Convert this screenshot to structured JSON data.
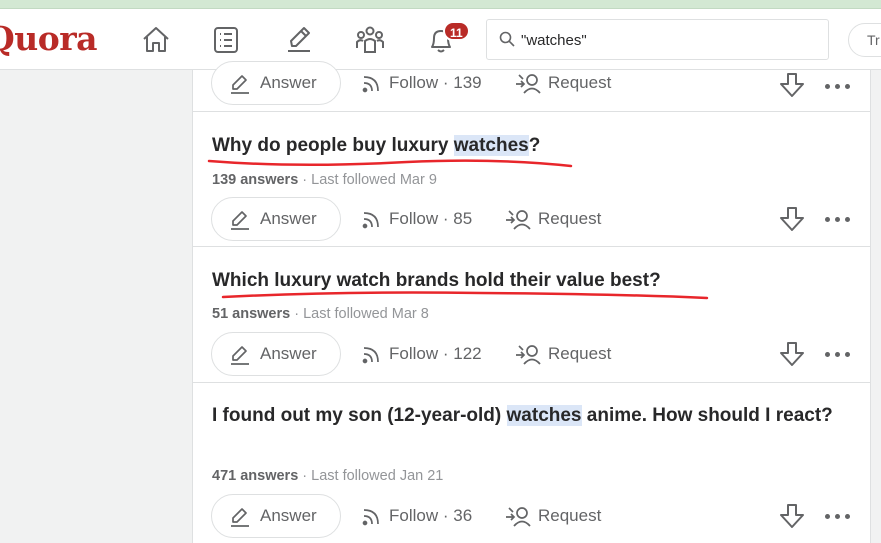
{
  "header": {
    "logo": "Quora",
    "notification_count": "11",
    "search_value": "\"watches\"",
    "try_label": "Tr"
  },
  "colors": {
    "brand": "#b92b27",
    "highlight": "#dbe6f7",
    "annotation": "#e8262b"
  },
  "feed": {
    "top_card": {
      "answer_label": "Answer",
      "follow_label": "Follow",
      "follow_count": "· 139",
      "request_label": "Request"
    },
    "cards": [
      {
        "title_parts": [
          "Why do people buy luxury ",
          "watches",
          "?"
        ],
        "answers": "139 answers",
        "last_followed": " · Last followed Mar 9",
        "answer_label": "Answer",
        "follow_label": "Follow",
        "follow_count": "· 85",
        "request_label": "Request"
      },
      {
        "title_parts": [
          "Which luxury watch brands hold their value best?"
        ],
        "answers": "51 answers",
        "last_followed": " · Last followed Mar 8",
        "answer_label": "Answer",
        "follow_label": "Follow",
        "follow_count": "· 122",
        "request_label": "Request"
      },
      {
        "title_parts": [
          "I found out my son (12-year-old) ",
          "watches",
          " anime. How should I react?"
        ],
        "answers": "471 answers",
        "last_followed": " · Last followed Jan 21",
        "answer_label": "Answer",
        "follow_label": "Follow",
        "follow_count": "· 36",
        "request_label": "Request"
      }
    ]
  }
}
